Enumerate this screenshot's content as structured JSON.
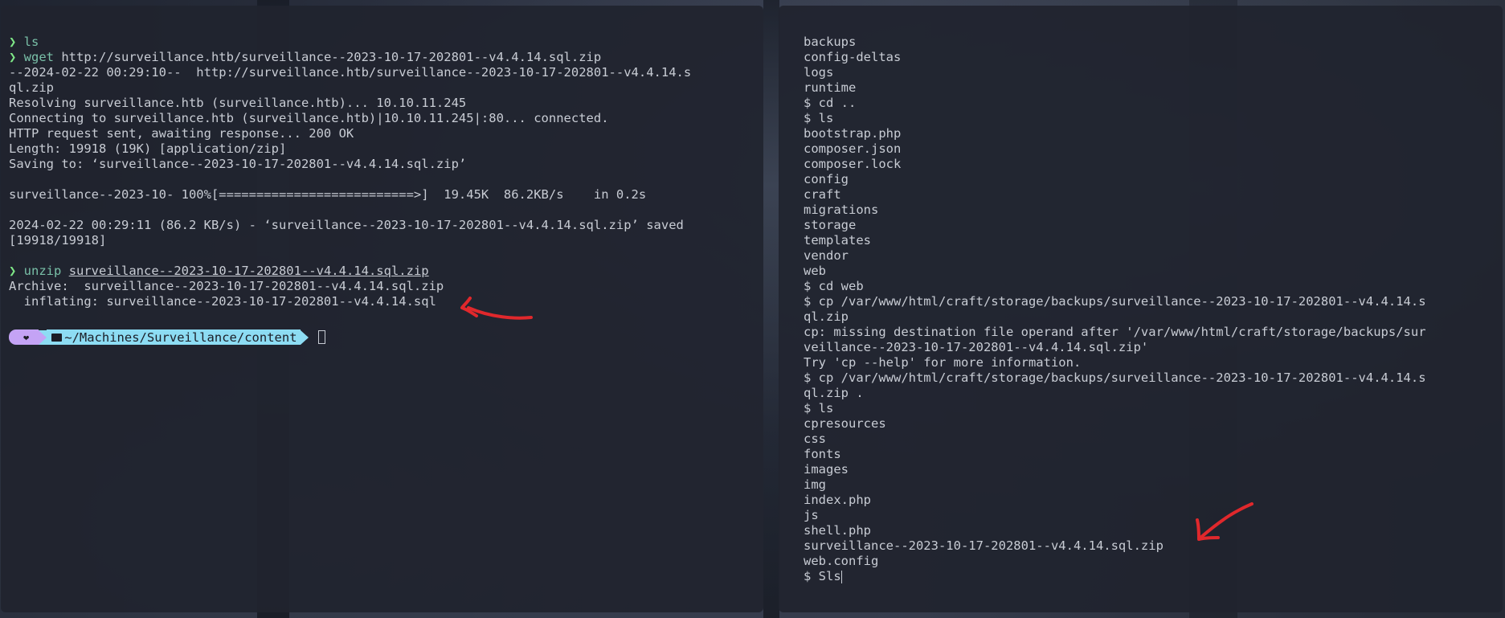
{
  "left_terminal": {
    "lines": [
      {
        "prompt": "❯ ",
        "cmd": "ls",
        "rest": ""
      },
      {
        "prompt": "❯ ",
        "cmd": "wget",
        "rest": " http://surveillance.htb/surveillance--2023-10-17-202801--v4.4.14.sql.zip"
      },
      {
        "text": "--2024-02-22 00:29:10--  http://surveillance.htb/surveillance--2023-10-17-202801--v4.4.14.s"
      },
      {
        "text": "ql.zip"
      },
      {
        "text": "Resolving surveillance.htb (surveillance.htb)... 10.10.11.245"
      },
      {
        "text": "Connecting to surveillance.htb (surveillance.htb)|10.10.11.245|:80... connected."
      },
      {
        "text": "HTTP request sent, awaiting response... 200 OK"
      },
      {
        "text": "Length: 19918 (19K) [application/zip]"
      },
      {
        "text": "Saving to: ‘surveillance--2023-10-17-202801--v4.4.14.sql.zip’"
      },
      {
        "text": ""
      },
      {
        "text": "surveillance--2023-10- 100%[==========================>]  19.45K  86.2KB/s    in 0.2s"
      },
      {
        "text": ""
      },
      {
        "text": "2024-02-22 00:29:11 (86.2 KB/s) - ‘surveillance--2023-10-17-202801--v4.4.14.sql.zip’ saved"
      },
      {
        "text": "[19918/19918]"
      },
      {
        "text": ""
      },
      {
        "prompt": "❯ ",
        "cmd": "unzip",
        "rest": " ",
        "arg": "surveillance--2023-10-17-202801--v4.4.14.sql.zip"
      },
      {
        "text": "Archive:  surveillance--2023-10-17-202801--v4.4.14.sql.zip"
      },
      {
        "text": "  inflating: surveillance--2023-10-17-202801--v4.4.14.sql"
      }
    ],
    "prompt_bar": {
      "heart": "❤",
      "path": "~/Machines/Surveillance/content"
    }
  },
  "right_terminal": {
    "lines": [
      "backups",
      "config-deltas",
      "logs",
      "runtime",
      "$ cd ..",
      "$ ls",
      "bootstrap.php",
      "composer.json",
      "composer.lock",
      "config",
      "craft",
      "migrations",
      "storage",
      "templates",
      "vendor",
      "web",
      "$ cd web",
      "$ cp /var/www/html/craft/storage/backups/surveillance--2023-10-17-202801--v4.4.14.s",
      "ql.zip",
      "cp: missing destination file operand after '/var/www/html/craft/storage/backups/sur",
      "veillance--2023-10-17-202801--v4.4.14.sql.zip'",
      "Try 'cp --help' for more information.",
      "$ cp /var/www/html/craft/storage/backups/surveillance--2023-10-17-202801--v4.4.14.s",
      "ql.zip .",
      "$ ls",
      "cpresources",
      "css",
      "fonts",
      "images",
      "img",
      "index.php",
      "js",
      "shell.php",
      "surveillance--2023-10-17-202801--v4.4.14.sql.zip",
      "web.config",
      "$ Sls"
    ]
  },
  "colors": {
    "terminal_bg": "#20242e",
    "text": "#c8ccd4",
    "prompt_green": "#7ee787",
    "prompt_purple": "#c4a3f5",
    "prompt_cyan": "#8ddcf3",
    "annotation_red": "#e0282c"
  },
  "icons": [
    "heart-icon",
    "folder-icon",
    "red-arrow-annotation"
  ]
}
